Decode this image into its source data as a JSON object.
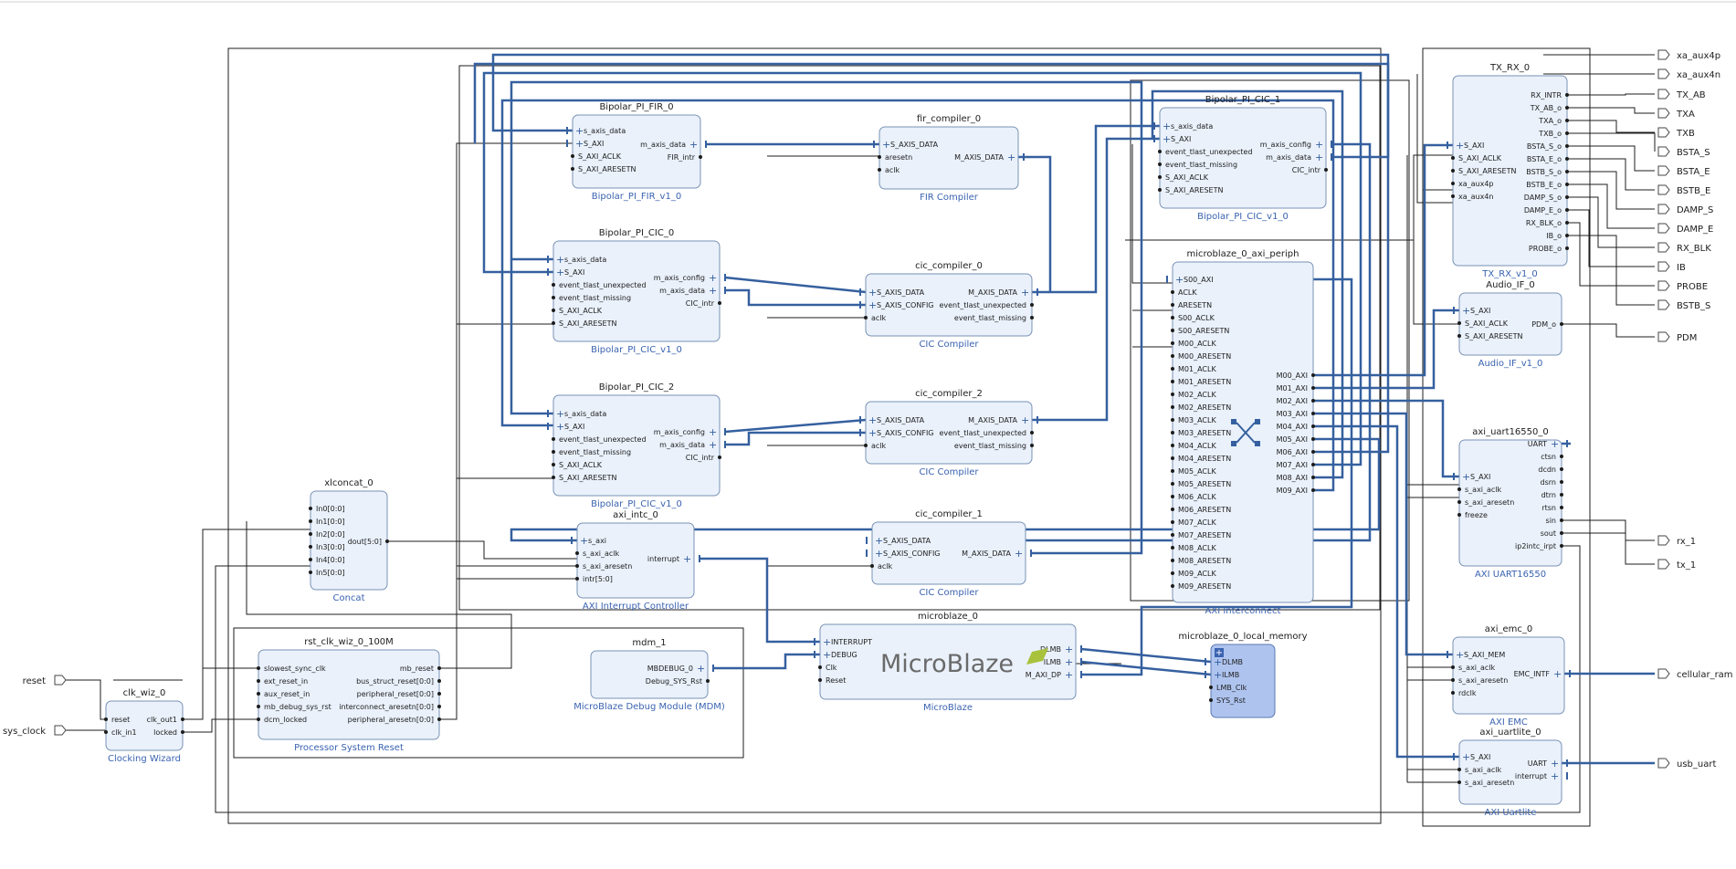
{
  "diagram": {
    "logo": "MicroBlaze",
    "external_ports": {
      "inputs": [
        "reset",
        "sys_clock"
      ],
      "outputs": [
        "xa_aux4p",
        "xa_aux4n",
        "TX_AB",
        "TXA",
        "TXB",
        "BSTA_S",
        "BSTA_E",
        "BSTB_E",
        "DAMP_S",
        "DAMP_E",
        "RX_BLK",
        "IB",
        "PROBE",
        "BSTB_S",
        "PDM",
        "rx_1",
        "tx_1",
        "cellular_ram",
        "usb_uart"
      ]
    },
    "blocks": [
      {
        "title": "Bipolar_PI_FIR_0",
        "sub": "Bipolar_PI_FIR_v1_0",
        "left": [
          "s_axis_data",
          "S_AXI",
          "S_AXI_ACLK",
          "S_AXI_ARESETN"
        ],
        "right": [
          "m_axis_data",
          "FIR_intr"
        ]
      },
      {
        "title": "Bipolar_PI_CIC_0",
        "sub": "Bipolar_PI_CIC_v1_0",
        "left": [
          "s_axis_data",
          "S_AXI",
          "event_tlast_unexpected",
          "event_tlast_missing",
          "S_AXI_ACLK",
          "S_AXI_ARESETN"
        ],
        "right": [
          "m_axis_config",
          "m_axis_data",
          "CIC_intr"
        ]
      },
      {
        "title": "Bipolar_PI_CIC_2",
        "sub": "Bipolar_PI_CIC_v1_0",
        "left": [
          "s_axis_data",
          "S_AXI",
          "event_tlast_unexpected",
          "event_tlast_missing",
          "S_AXI_ACLK",
          "S_AXI_ARESETN"
        ],
        "right": [
          "m_axis_config",
          "m_axis_data",
          "CIC_intr"
        ]
      },
      {
        "title": "Bipolar_PI_CIC_1",
        "sub": "Bipolar_PI_CIC_v1_0",
        "left": [
          "s_axis_data",
          "S_AXI",
          "event_tlast_unexpected",
          "event_tlast_missing",
          "S_AXI_ACLK",
          "S_AXI_ARESETN"
        ],
        "right": [
          "m_axis_config",
          "m_axis_data",
          "CIC_intr"
        ]
      },
      {
        "title": "fir_compiler_0",
        "sub": "FIR Compiler",
        "left": [
          "S_AXIS_DATA",
          "aresetn",
          "aclk"
        ],
        "right": [
          "M_AXIS_DATA"
        ]
      },
      {
        "title": "cic_compiler_0",
        "sub": "CIC Compiler",
        "left": [
          "S_AXIS_DATA",
          "S_AXIS_CONFIG",
          "aclk"
        ],
        "right": [
          "M_AXIS_DATA",
          "event_tlast_unexpected",
          "event_tlast_missing"
        ]
      },
      {
        "title": "cic_compiler_2",
        "sub": "CIC Compiler",
        "left": [
          "S_AXIS_DATA",
          "S_AXIS_CONFIG",
          "aclk"
        ],
        "right": [
          "M_AXIS_DATA",
          "event_tlast_unexpected",
          "event_tlast_missing"
        ]
      },
      {
        "title": "cic_compiler_1",
        "sub": "CIC Compiler",
        "left": [
          "S_AXIS_DATA",
          "S_AXIS_CONFIG",
          "aclk"
        ],
        "right": [
          "M_AXIS_DATA"
        ]
      },
      {
        "title": "xlconcat_0",
        "sub": "Concat",
        "left": [
          "In0[0:0]",
          "In1[0:0]",
          "In2[0:0]",
          "In3[0:0]",
          "In4[0:0]",
          "In5[0:0]"
        ],
        "right": [
          "dout[5:0]"
        ]
      },
      {
        "title": "axi_intc_0",
        "sub": "AXI Interrupt Controller",
        "left": [
          "s_axi",
          "s_axi_aclk",
          "s_axi_aresetn",
          "intr[5:0]"
        ],
        "right": [
          "interrupt"
        ]
      },
      {
        "title": "rst_clk_wiz_0_100M",
        "sub": "Processor System Reset",
        "left": [
          "slowest_sync_clk",
          "ext_reset_in",
          "aux_reset_in",
          "mb_debug_sys_rst",
          "dcm_locked"
        ],
        "right": [
          "mb_reset",
          "bus_struct_reset[0:0]",
          "peripheral_reset[0:0]",
          "interconnect_aresetn[0:0]",
          "peripheral_aresetn[0:0]"
        ]
      },
      {
        "title": "clk_wiz_0",
        "sub": "Clocking Wizard",
        "left": [
          "reset",
          "clk_in1"
        ],
        "right": [
          "clk_out1",
          "locked"
        ]
      },
      {
        "title": "mdm_1",
        "sub": "MicroBlaze Debug Module (MDM)",
        "left": [],
        "right": [
          "MBDEBUG_0",
          "Debug_SYS_Rst"
        ]
      },
      {
        "title": "microblaze_0",
        "sub": "MicroBlaze",
        "left": [
          "INTERRUPT",
          "DEBUG",
          "Clk",
          "Reset"
        ],
        "right": [
          "DLMB",
          "ILMB",
          "M_AXI_DP"
        ]
      },
      {
        "title": "microblaze_0_local_memory",
        "sub": "",
        "left": [
          "DLMB",
          "ILMB",
          "LMB_Clk",
          "SYS_Rst"
        ],
        "right": []
      },
      {
        "title": "microblaze_0_axi_periph",
        "sub": "AXI Interconnect",
        "left": [
          "S00_AXI",
          "ACLK",
          "ARESETN",
          "S00_ACLK",
          "S00_ARESETN",
          "M00_ACLK",
          "M00_ARESETN",
          "M01_ACLK",
          "M01_ARESETN",
          "M02_ACLK",
          "M02_ARESETN",
          "M03_ACLK",
          "M03_ARESETN",
          "M04_ACLK",
          "M04_ARESETN",
          "M05_ACLK",
          "M05_ARESETN",
          "M06_ACLK",
          "M06_ARESETN",
          "M07_ACLK",
          "M07_ARESETN",
          "M08_ACLK",
          "M08_ARESETN",
          "M09_ACLK",
          "M09_ARESETN"
        ],
        "right": [
          "M00_AXI",
          "M01_AXI",
          "M02_AXI",
          "M03_AXI",
          "M04_AXI",
          "M05_AXI",
          "M06_AXI",
          "M07_AXI",
          "M08_AXI",
          "M09_AXI"
        ]
      },
      {
        "title": "TX_RX_0",
        "sub": "TX_RX_v1_0",
        "left": [
          "S_AXI",
          "S_AXI_ACLK",
          "S_AXI_ARESETN",
          "xa_aux4p",
          "xa_aux4n"
        ],
        "right": [
          "RX_INTR",
          "TX_AB_o",
          "TXA_o",
          "TXB_o",
          "BSTA_S_o",
          "BSTA_E_o",
          "BSTB_S_o",
          "BSTB_E_o",
          "DAMP_S_o",
          "DAMP_E_o",
          "RX_BLK_o",
          "IB_o",
          "PROBE_o"
        ]
      },
      {
        "title": "Audio_IF_0",
        "sub": "Audio_IF_v1_0",
        "left": [
          "S_AXI",
          "S_AXI_ACLK",
          "S_AXI_ARESETN"
        ],
        "right": [
          "PDM_o"
        ]
      },
      {
        "title": "axi_uart16550_0",
        "sub": "AXI UART16550",
        "left": [
          "S_AXI",
          "s_axi_aclk",
          "s_axi_aresetn",
          "freeze"
        ],
        "right": [
          "UART",
          "ctsn",
          "dcdn",
          "dsrn",
          "dtrn",
          "rtsn",
          "sin",
          "sout",
          "ip2intc_irpt"
        ]
      },
      {
        "title": "axi_emc_0",
        "sub": "AXI EMC",
        "left": [
          "S_AXI_MEM",
          "s_axi_aclk",
          "s_axi_aresetn",
          "rdclk"
        ],
        "right": [
          "EMC_INTF"
        ]
      },
      {
        "title": "axi_uartlite_0",
        "sub": "AXI Uartlite",
        "left": [
          "S_AXI",
          "s_axi_aclk",
          "s_axi_aresetn"
        ],
        "right": [
          "UART",
          "interrupt"
        ]
      }
    ]
  }
}
